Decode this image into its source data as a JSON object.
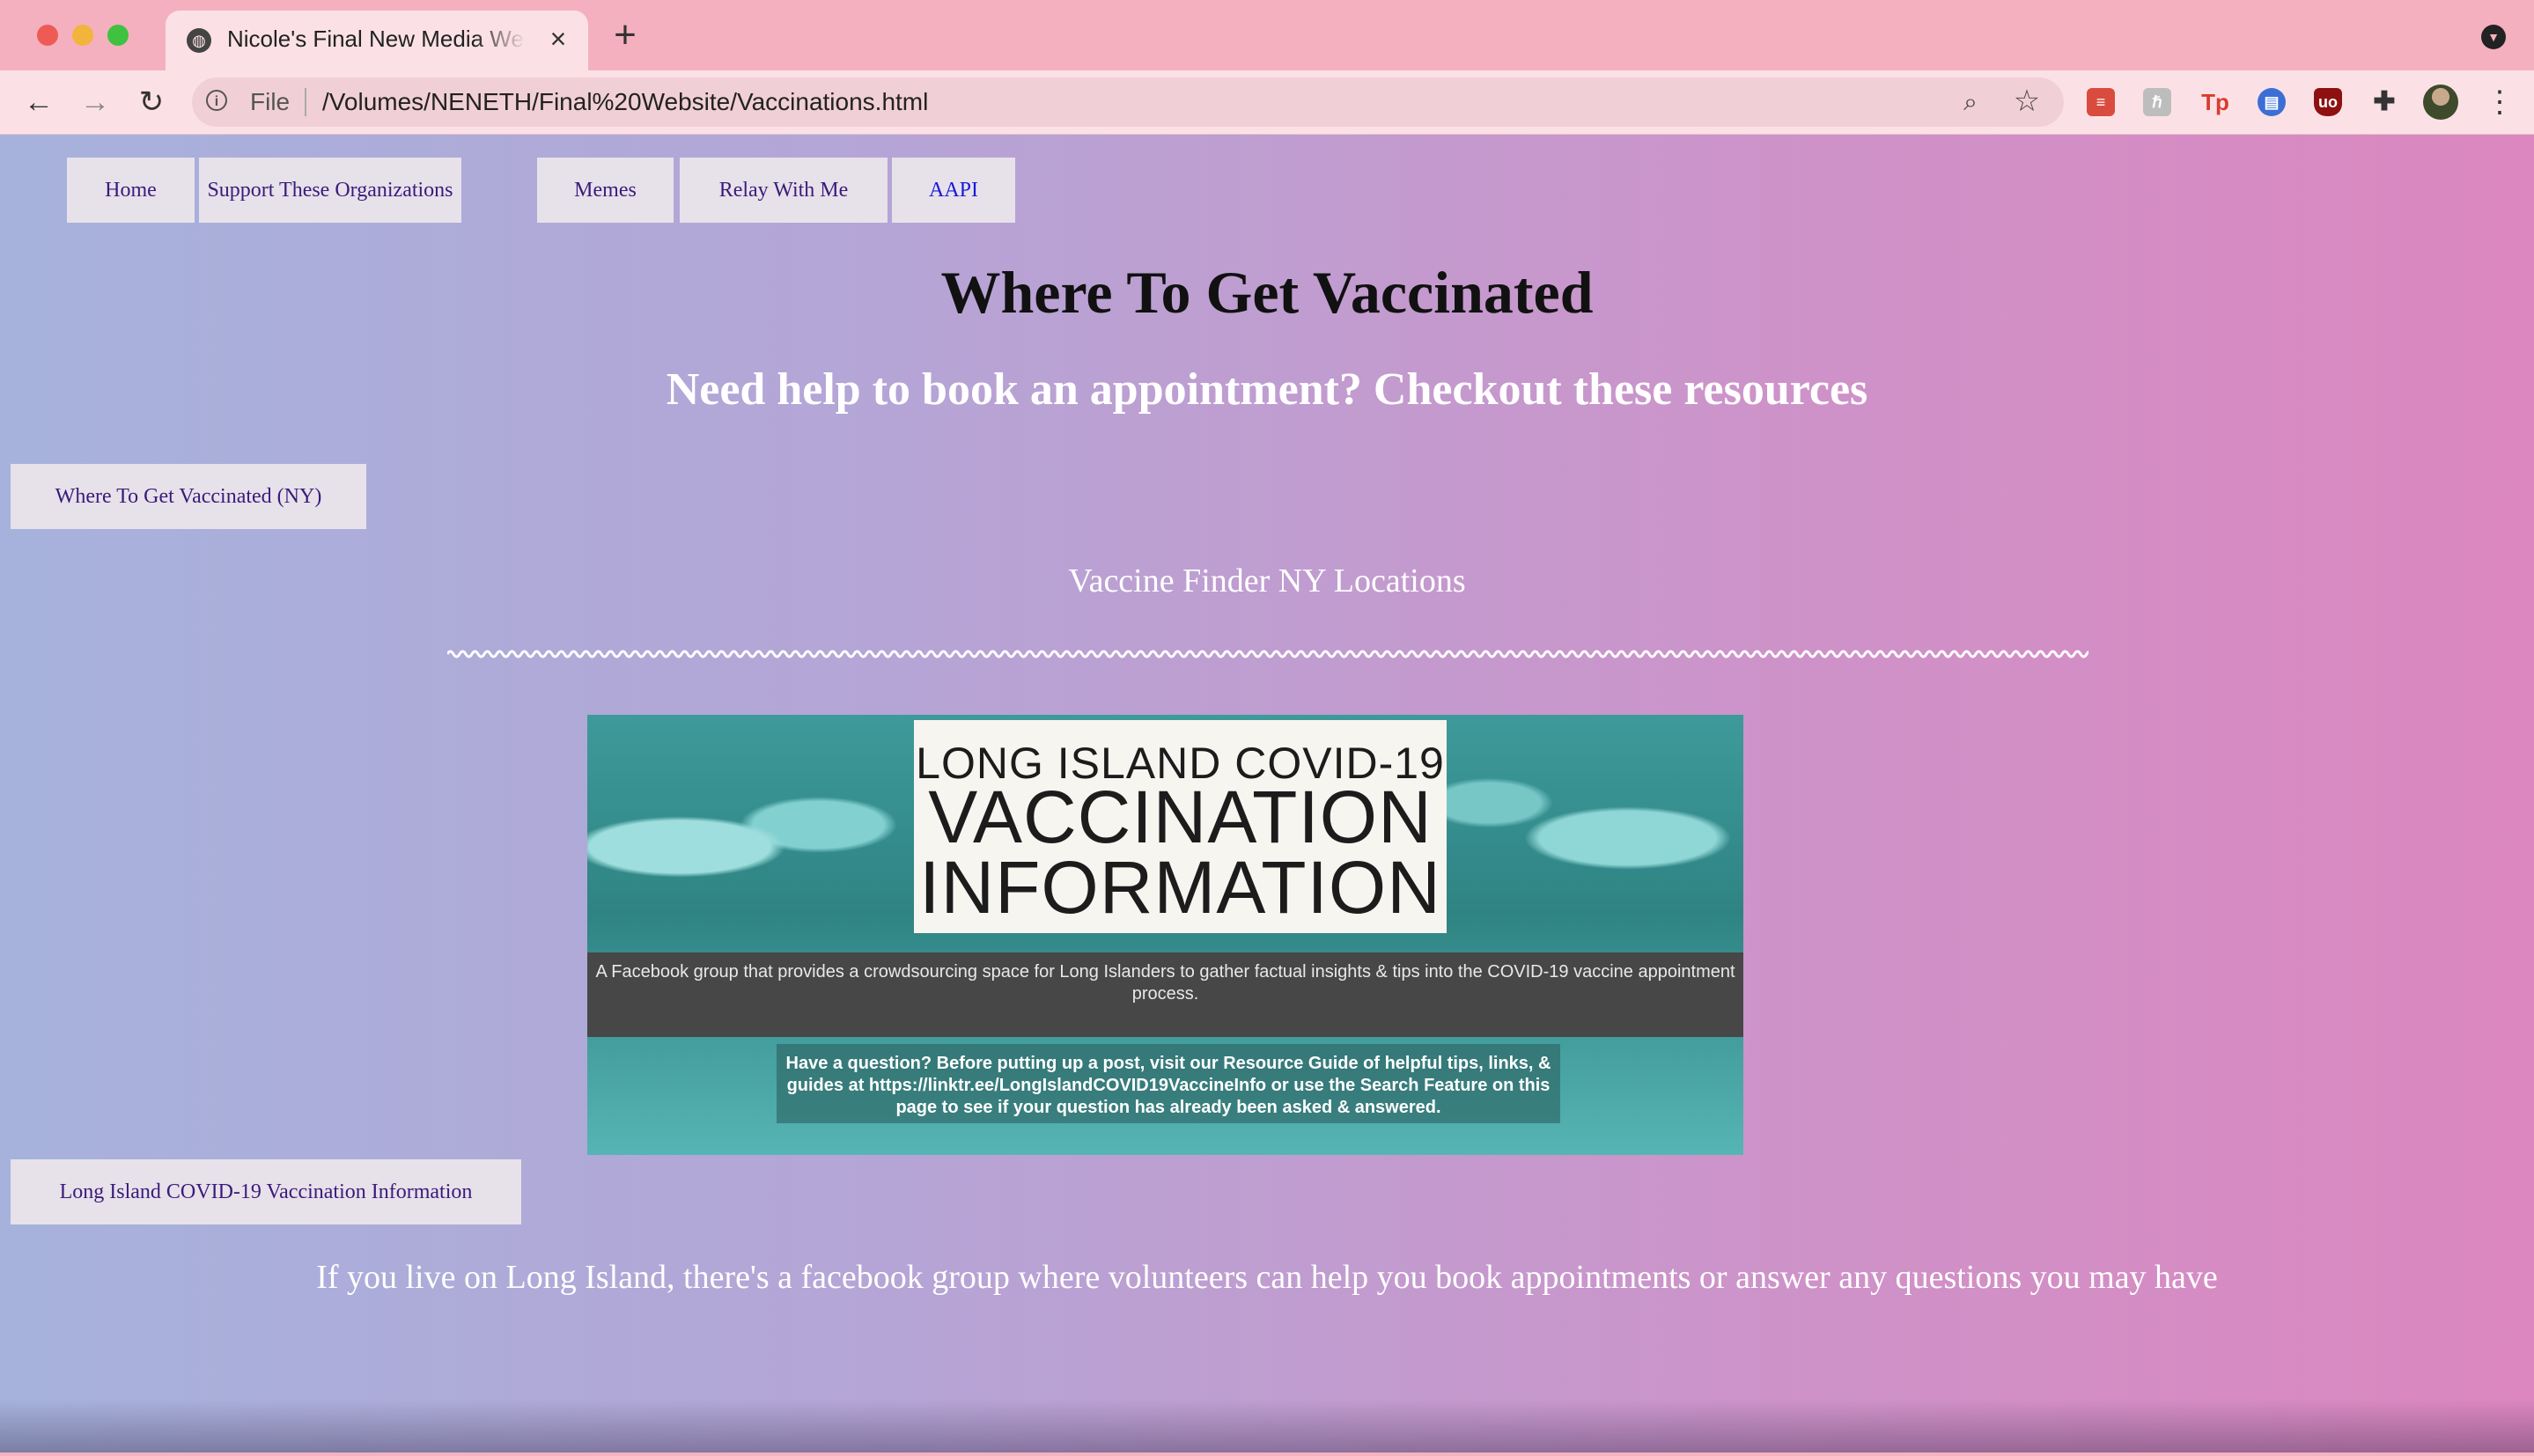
{
  "browser": {
    "tab_title": "Nicole's Final New Media Website",
    "file_label": "File",
    "url": "/Volumes/NENETH/Final%20Website/Vaccinations.html",
    "extensions": [
      {
        "name": "ext-stack-icon",
        "glyph": "≡"
      },
      {
        "name": "ext-puzzle-grey-icon",
        "glyph": "ℏ"
      },
      {
        "name": "ext-tp-icon",
        "glyph": "Tp"
      },
      {
        "name": "ext-blue-doc-icon",
        "glyph": "▤"
      },
      {
        "name": "ext-ublock-icon",
        "glyph": "uo"
      },
      {
        "name": "extensions-puzzle-icon",
        "glyph": "✚"
      }
    ],
    "colors": {
      "tabstrip": "#f4b0be",
      "toolbar": "#fbe1e6"
    }
  },
  "page": {
    "nav": {
      "home": "Home",
      "support": "Support These Organizations",
      "memes": "Memes",
      "relay": "Relay With Me",
      "aapi": "AAPI"
    },
    "title": "Where To Get Vaccinated",
    "subtitle": "Need help to book an appointment? Checkout these resources",
    "ny_button": "Where To Get Vaccinated (NY)",
    "finder_link": "Vaccine Finder NY Locations",
    "banner": {
      "line1": "LONG ISLAND COVID-19",
      "line2": "VACCINATION",
      "line3": "INFORMATION",
      "strip": "A Facebook group that provides a crowdsourcing space for Long Islanders to gather factual insights & tips into the COVID-19 vaccine appointment process.",
      "note": "Have a question? Before putting up a post, visit our Resource Guide of helpful tips, links, & guides at https://linktr.ee/LongIslandCOVID19VaccineInfo or use the Search Feature on this page to see if your question has already been asked & answered."
    },
    "li_button": "Long Island COVID-19 Vaccination Information",
    "footer": "If you live on Long Island, there's a facebook group where volunteers can help you book appointments or answer any questions you may have",
    "colors": {
      "gradient_left": "#a6b2dc",
      "gradient_right": "#dc87bf",
      "button_bg": "#e7e1ea"
    }
  }
}
